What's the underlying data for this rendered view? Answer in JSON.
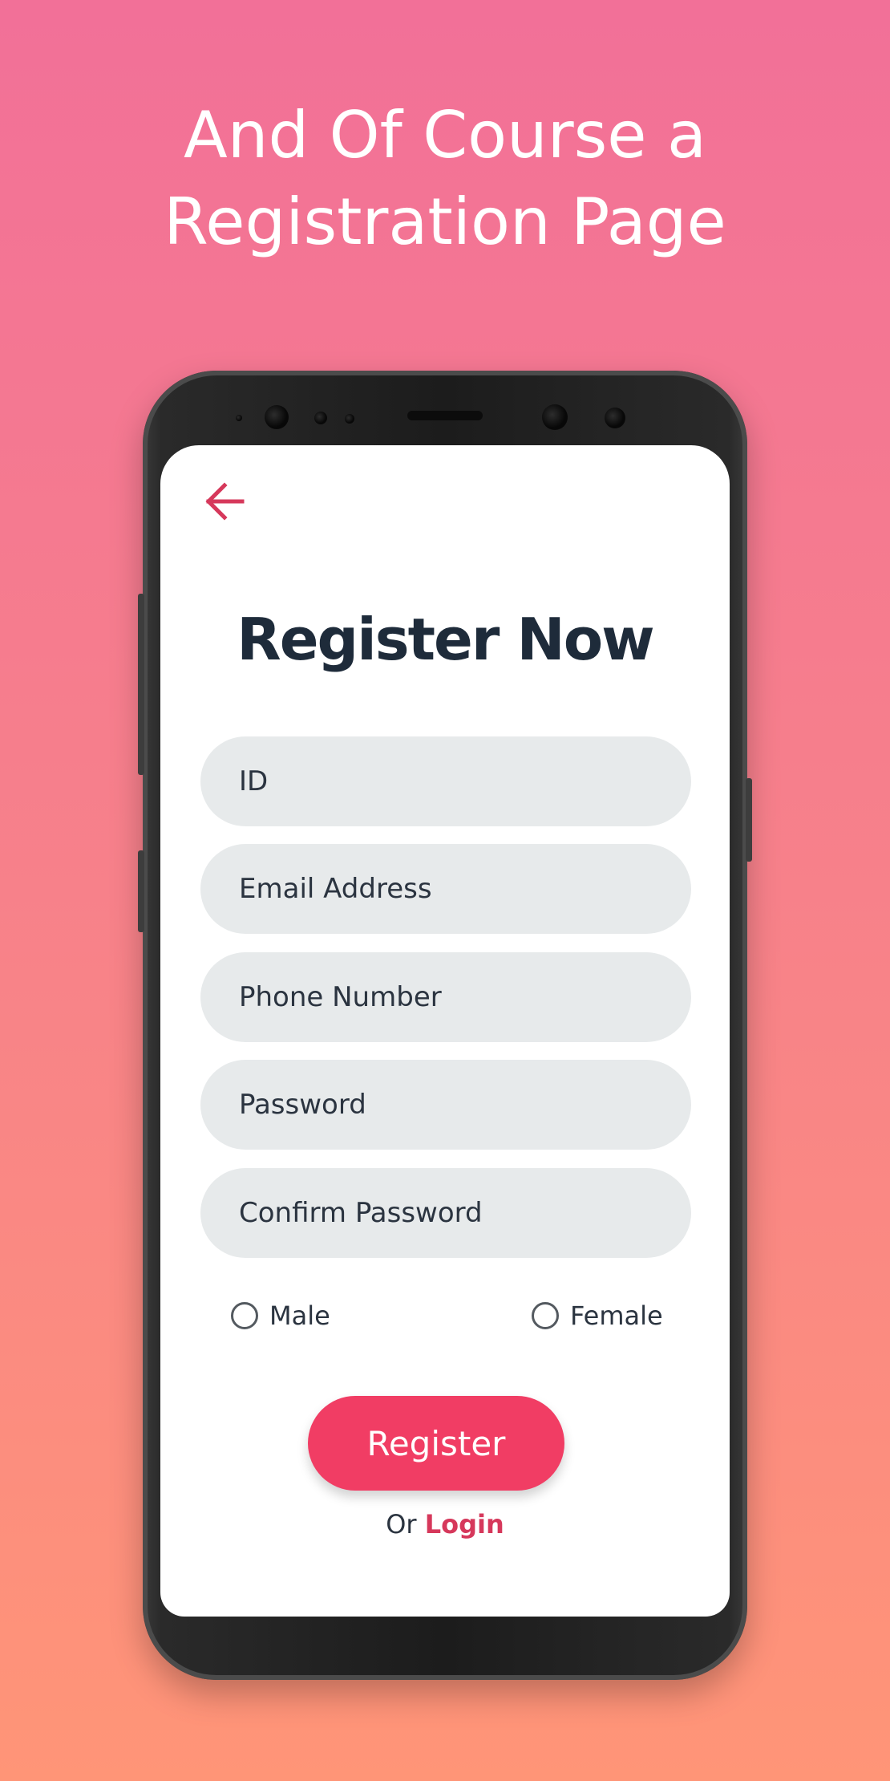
{
  "headline": {
    "line1": "And Of Course a",
    "line2": "Registration Page"
  },
  "screen": {
    "back_icon": "arrow-left-icon",
    "title": "Register Now",
    "fields": {
      "id_placeholder": "ID",
      "email_placeholder": "Email Address",
      "phone_placeholder": "Phone Number",
      "password_placeholder": "Password",
      "confirm_password_placeholder": "Confirm Password"
    },
    "gender": {
      "male_label": "Male",
      "female_label": "Female"
    },
    "register_label": "Register",
    "or_label": "Or",
    "login_label": "Login"
  },
  "colors": {
    "background_top": "#f27098",
    "background_bottom": "#ff9577",
    "accent": "#f13d64",
    "title_text": "#1e2b3a",
    "field_background": "#e7eaeb"
  }
}
